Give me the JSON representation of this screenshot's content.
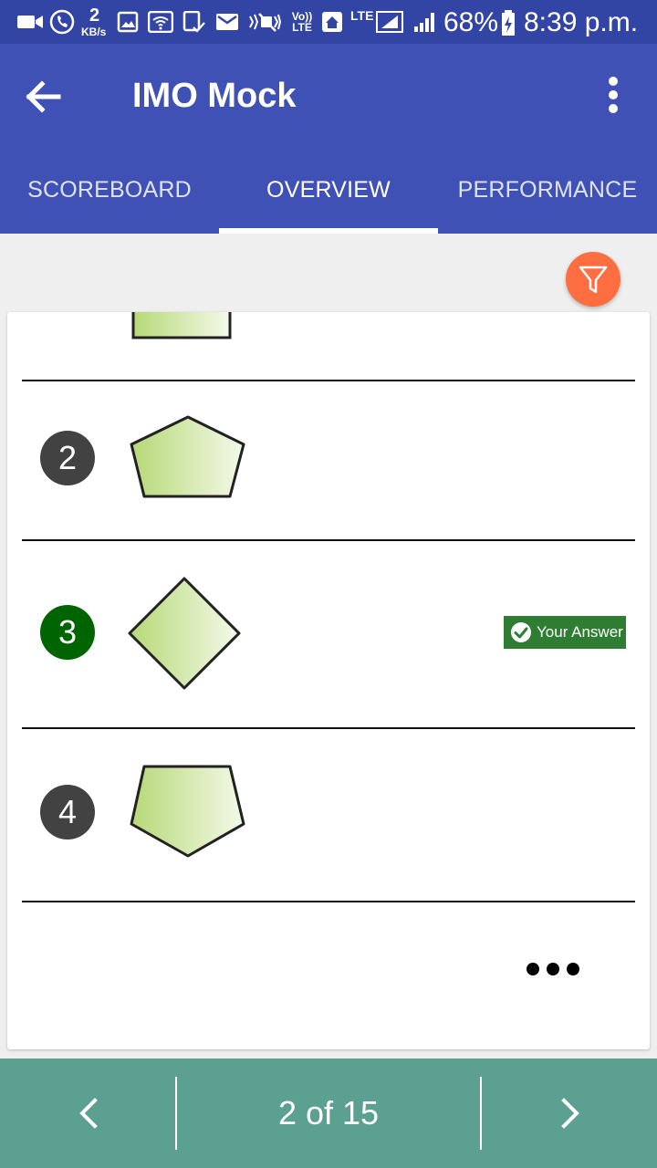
{
  "status_bar": {
    "network_speed": "2",
    "network_speed_unit": "KB/s",
    "volte_label": "Vo)) LTE",
    "lte_label": "LTE",
    "battery": "68%",
    "time": "8:39 p.m.",
    "icons": [
      "video-icon",
      "call-icon",
      "image-icon",
      "wifi-icon",
      "clipboard-icon",
      "mail-icon",
      "mute-icon",
      "home-icon",
      "signal-icon",
      "battery-icon"
    ]
  },
  "app_bar": {
    "title": "IMO Mock",
    "back_icon": "arrow-back-icon",
    "menu_icon": "more-vert-icon"
  },
  "tabs": [
    {
      "label": "SCOREBOARD",
      "active": false
    },
    {
      "label": "OVERVIEW",
      "active": true
    },
    {
      "label": "PERFORMANCE",
      "active": false
    }
  ],
  "filter_icon": "filter-icon",
  "options": [
    {
      "number": "2",
      "shape": "pentagon",
      "correct": false,
      "your_answer": false
    },
    {
      "number": "3",
      "shape": "diamond",
      "correct": true,
      "your_answer": true
    },
    {
      "number": "4",
      "shape": "pentagon-inverted",
      "correct": false,
      "your_answer": false
    }
  ],
  "your_answer_label": "Your Answer",
  "more_icon": "more-horiz-icon",
  "bottom_nav": {
    "page_indicator": "2 of 15",
    "prev_icon": "chevron-left-icon",
    "next_icon": "chevron-right-icon"
  },
  "colors": {
    "status_bar": "#3245a4",
    "app_bar": "#3f51b5",
    "filter_fab": "#ff6e40",
    "correct": "#006400",
    "badge": "#2e7d32",
    "bottom_nav": "#5ba090"
  }
}
